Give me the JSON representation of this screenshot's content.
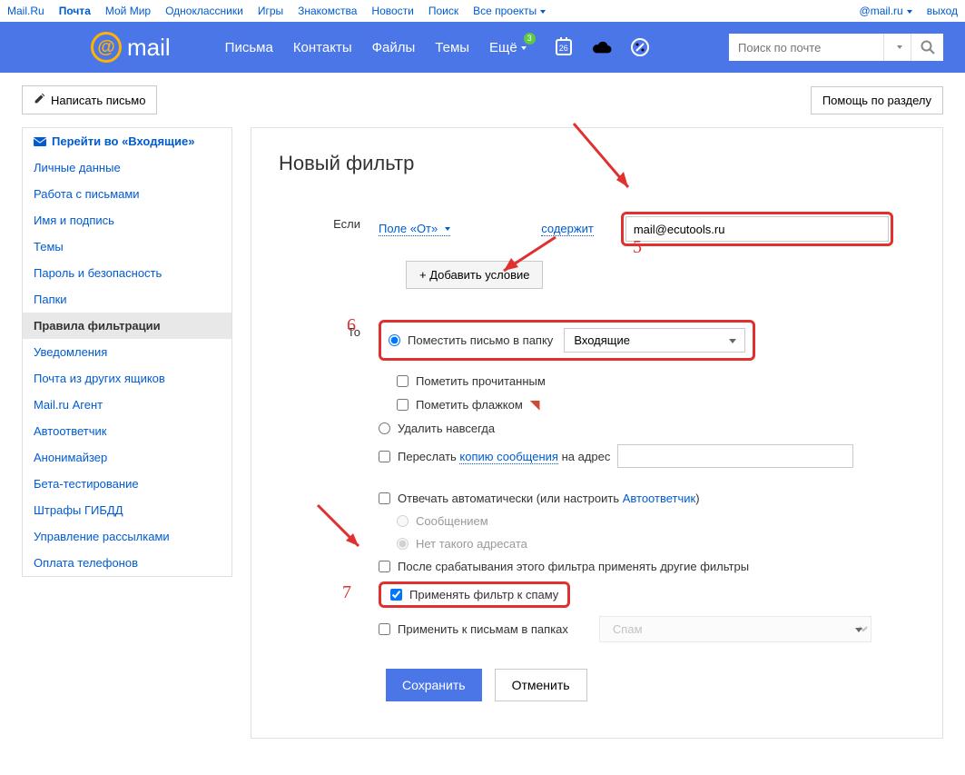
{
  "top_nav": {
    "left": [
      "Mail.Ru",
      "Почта",
      "Мой Мир",
      "Одноклассники",
      "Игры",
      "Знакомства",
      "Новости",
      "Поиск",
      "Все проекты"
    ],
    "active_index": 1,
    "email": "@mail.ru",
    "logout": "выход"
  },
  "header": {
    "logo": "mail",
    "nav": [
      "Письма",
      "Контакты",
      "Файлы",
      "Темы",
      "Ещё"
    ],
    "badge_count": "3",
    "calendar_date": "26",
    "search_placeholder": "Поиск по почте"
  },
  "toolbar": {
    "compose": "Написать письмо",
    "help": "Помощь по разделу"
  },
  "sidebar": {
    "inbox": "Перейти во «Входящие»",
    "items": [
      "Личные данные",
      "Работа с письмами",
      "Имя и подпись",
      "Темы",
      "Пароль и безопасность",
      "Папки",
      "Правила фильтрации",
      "Уведомления",
      "Почта из других ящиков",
      "Mail.ru Агент",
      "Автоответчик",
      "Анонимайзер",
      "Бета-тестирование",
      "Штрафы ГИБДД",
      "Управление рассылками",
      "Оплата телефонов"
    ],
    "active_index": 6
  },
  "page": {
    "title": "Новый фильтр",
    "if_label": "Если",
    "then_label": "То",
    "field_from": "Поле «От»",
    "contains": "содержит",
    "cond_value": "mail@ecutools.ru",
    "add_condition": "+  Добавить условие",
    "actions": {
      "move_to_folder": "Поместить письмо в папку",
      "folder_options": [
        "Входящие"
      ],
      "folder_selected": "Входящие",
      "mark_read": "Пометить прочитанным",
      "mark_flag": "Пометить флажком",
      "delete_forever": "Удалить навсегда",
      "forward_pre": "Переслать ",
      "forward_link": "копию сообщения",
      "forward_post": " на адрес",
      "auto_reply_pre": "Отвечать автоматически (или настроить ",
      "auto_reply_link": "Автоответчик",
      "auto_reply_post": ")",
      "reply_message": "Сообщением",
      "reply_noaddr": "Нет такого адресата",
      "apply_other": "После срабатывания этого фильтра применять другие фильтры",
      "apply_spam": "Применять фильтр к спаму",
      "apply_folders": "Применить к письмам в папках",
      "apply_folders_value": "Спам"
    },
    "save": "Сохранить",
    "cancel": "Отменить"
  },
  "annotations": {
    "n5": "5",
    "n6": "6",
    "n7": "7"
  }
}
